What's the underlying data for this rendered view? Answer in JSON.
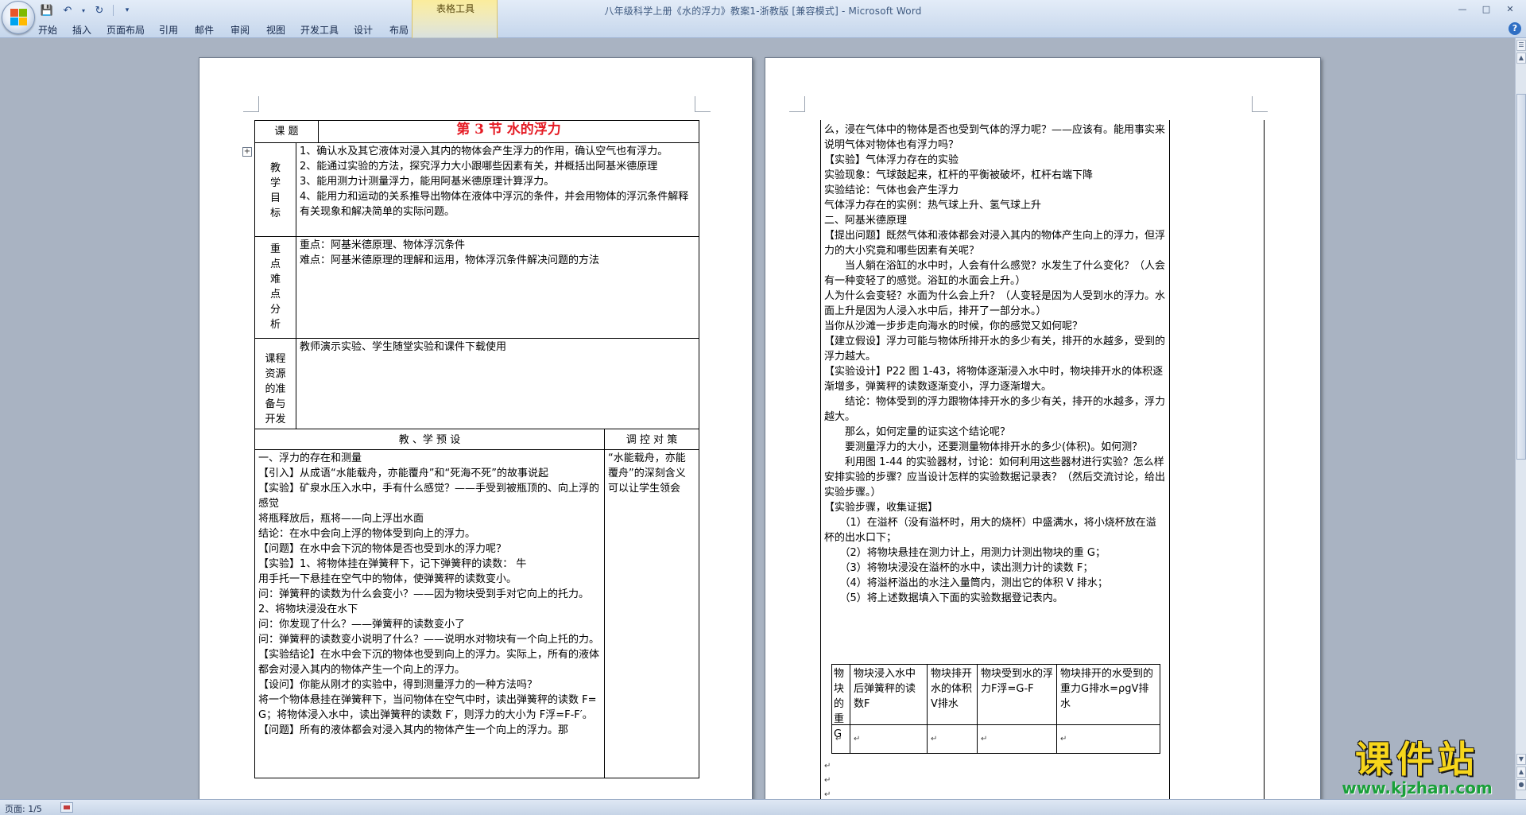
{
  "app": {
    "window_title": "八年级科学上册《水的浮力》教案1-浙教版 [兼容模式] - Microsoft Word",
    "tool_tab_group": "表格工具",
    "ribbon_tabs": [
      "开始",
      "插入",
      "页面布局",
      "引用",
      "邮件",
      "审阅",
      "视图",
      "开发工具",
      "设计",
      "布局"
    ],
    "help": "?"
  },
  "status": {
    "page": "页面: 1/5"
  },
  "watermark": {
    "main": "课件站",
    "url": "www.kjzhan.com"
  },
  "page1": {
    "row1_label": "课  题",
    "title": "第 3 节    水的浮力",
    "row2_label": [
      "教",
      "学",
      "目",
      "标"
    ],
    "objectives": [
      "1、确认水及其它液体对浸入其内的物体会产生浮力的作用，确认空气也有浮力。",
      "2、能通过实验的方法，探究浮力大小跟哪些因素有关，并概括出阿基米德原理",
      "3、能用测力计测量浮力，能用阿基米德原理计算浮力。",
      "4、能用力和运动的关系推导出物体在液体中浮沉的条件，并会用物体的浮沉条件解释有关现象和解决简单的实际问题。"
    ],
    "row3_label": [
      "重",
      "点",
      "难",
      "点",
      "分",
      "析"
    ],
    "keypoints": [
      "重点：阿基米德原理、物体浮沉条件",
      "难点：阿基米德原理的理解和运用，物体浮沉条件解决问题的方法"
    ],
    "row4_label": [
      "课程",
      "资源",
      "的准",
      "备与",
      "开发"
    ],
    "resources": "教师演示实验、学生随堂实验和课件下载使用",
    "col_head_left": "教  、学 预 设",
    "col_head_right": "调 控 对 策",
    "teaching": [
      "一、浮力的存在和测量",
      "【引入】从成语“水能载舟，亦能覆舟”和“死海不死”的故事说起",
      "【实验】矿泉水压入水中，手有什么感觉？——手受到被瓶顶的、向上浮的感觉",
      "将瓶释放后，瓶将——向上浮出水面",
      "结论：在水中会向上浮的物体受到向上的浮力。",
      "【问题】在水中会下沉的物体是否也受到水的浮力呢？",
      "【实验】1、将物体挂在弹簧秤下，记下弹簧秤的读数：           牛",
      "用手托一下悬挂在空气中的物体，使弹簧秤的读数变小。",
      "问：弹簧秤的读数为什么会变小？——因为物块受到手对它向上的托力。",
      "2、将物块浸没在水下",
      "问：你发现了什么？——弹簧秤的读数变小了",
      "问：弹簧秤的读数变小说明了什么？——说明水对物块有一个向上托的力。",
      "【实验结论】在水中会下沉的物体也受到向上的浮力。实际上，所有的液体都会对浸入其内的物体产生一个向上的浮力。",
      "【设问】你能从刚才的实验中，得到测量浮力的一种方法吗？",
      "将一个物体悬挂在弹簧秤下，当问物体在空气中时，读出弹簧秤的读数 F=G；将物体浸入水中，读出弹簧秤的读数 F′，则浮力的大小为 F浮=F-F′。",
      "【问题】所有的液体都会对浸入其内的物体产生一个向上的浮力。那"
    ],
    "strategy": "“水能载舟，亦能覆舟”的深刻含义可以让学生领会"
  },
  "page2": {
    "paragraphs": [
      "么，浸在气体中的物体是否也受到气体的浮力呢？——应该有。能用事实来说明气体对物体也有浮力吗？",
      "【实验】气体浮力存在的实验",
      "实验现象：气球鼓起来，杠杆的平衡被破坏，杠杆右端下降",
      "实验结论：气体也会产生浮力",
      "气体浮力存在的实例：热气球上升、氢气球上升",
      "二、阿基米德原理",
      "【提出问题】既然气体和液体都会对浸入其内的物体产生向上的浮力，但浮力的大小究竟和哪些因素有关呢？",
      "　　当人躺在浴缸的水中时，人会有什么感觉？水发生了什么变化？（人会有一种变轻了的感觉。浴缸的水面会上升。）",
      "人为什么会变轻？水面为什么会上升？（人变轻是因为人受到水的浮力。水面上升是因为人浸入水中后，排开了一部分水。）",
      "当你从沙滩一步步走向海水的时候，你的感觉又如何呢？",
      "【建立假设】浮力可能与物体所排开水的多少有关，排开的水越多，受到的浮力越大。",
      "【实验设计】P22 图 1-43，将物体逐渐浸入水中时，物块排开水的体积逐渐增多，弹簧秤的读数逐渐变小，浮力逐渐增大。",
      "　　结论：物体受到的浮力跟物体排开水的多少有关，排开的水越多，浮力越大。",
      "　　那么，如何定量的证实这个结论呢？",
      "　　要测量浮力的大小，还要测量物体排开水的多少(体积)。如何测？",
      "　　利用图 1-44 的实验器材，讨论：如何利用这些器材进行实验？怎么样安排实验的步骤？应当设计怎样的实验数据记录表？（然后交流讨论，给出实验步骤。）",
      "【实验步骤，收集证据】",
      "　　（1）在溢杯（没有溢杯时，用大的烧杯）中盛满水，将小烧杯放在溢杯的出水口下；",
      "　　（2）将物块悬挂在测力计上，用测力计测出物块的重 G；",
      "　　（3）将物块浸没在溢杯的水中，读出测力计的读数 F；",
      "　　（4）将溢杯溢出的水注入量筒内，测出它的体积 V 排水；",
      "　　（5）将上述数据填入下面的实验数据登记表内。"
    ],
    "data_table_headers": [
      "物块的重G",
      "物块浸入水中后弹簧秤的读数F",
      "物块排开水的体积V排水",
      "物块受到水的浮力F浮=G-F",
      "物块排开的水受到的重力G排水=ρgV排水"
    ],
    "para_mark": "↵"
  }
}
